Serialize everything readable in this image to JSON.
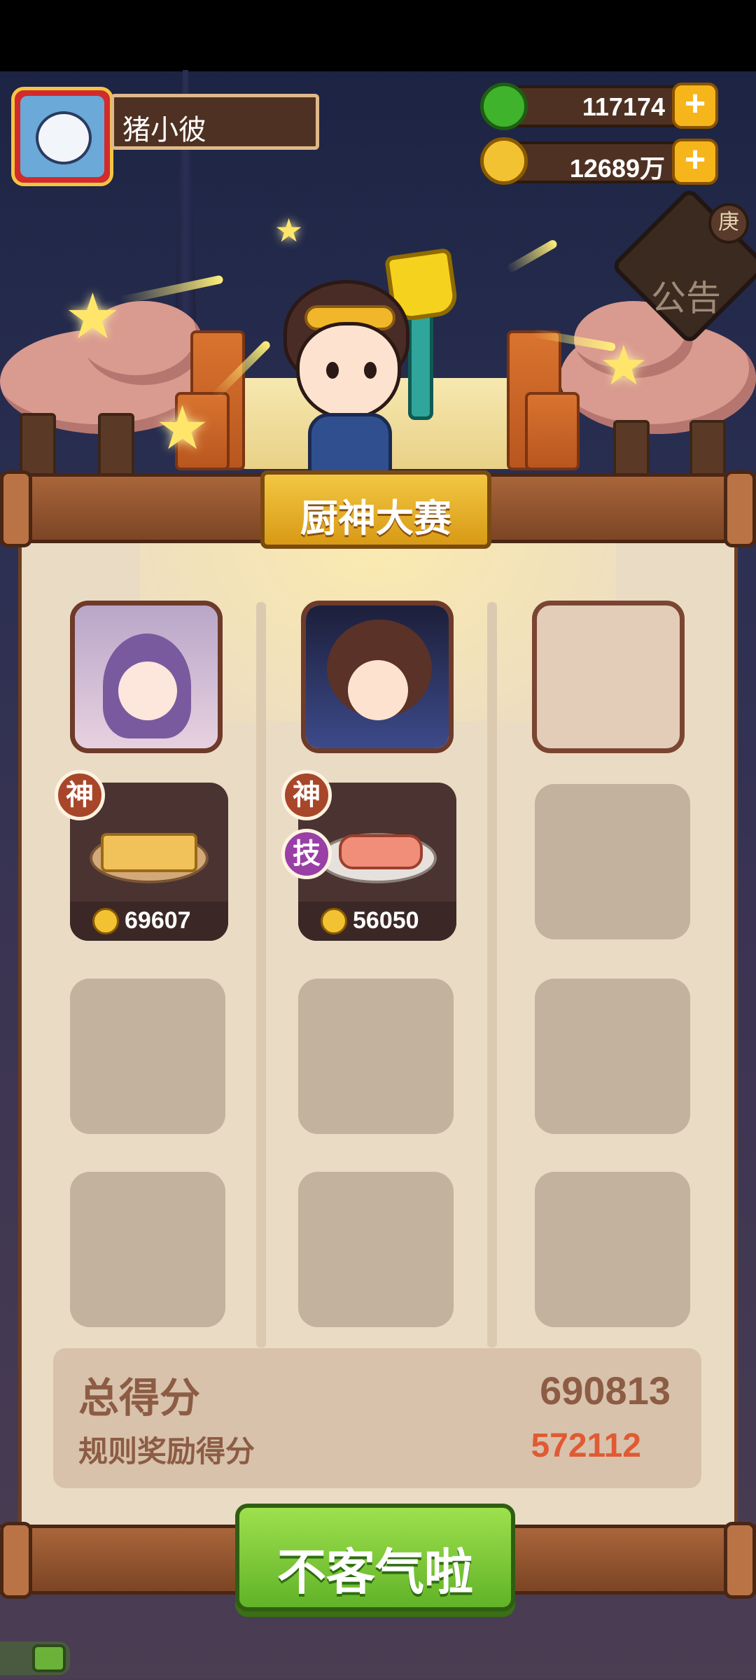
{
  "player": {
    "name": "猪小彼"
  },
  "currency": {
    "jade": {
      "value": "117174",
      "icon": "jade-icon",
      "color": "#3fb32b"
    },
    "gold": {
      "value": "12689万",
      "icon": "gold-coin-icon",
      "color": "#f3c233"
    },
    "plus_label": "+"
  },
  "notice": {
    "label": "公告",
    "badge": "庚"
  },
  "contest": {
    "title": "厨神大赛"
  },
  "columns": [
    {
      "chef": "chef-portrait-1",
      "dish_score": "69607",
      "badges": [
        "神"
      ]
    },
    {
      "chef": "chef-portrait-2",
      "dish_score": "56050",
      "badges": [
        "神",
        "技"
      ]
    },
    {
      "chef": "empty",
      "dish_score": "",
      "badges": []
    }
  ],
  "scores": {
    "total_label": "总得分",
    "total_value": "690813",
    "bonus_label": "规则奖励得分",
    "bonus_value": "572112"
  },
  "action": {
    "label": "不客气啦"
  },
  "colors": {
    "accent_green": "#61b328",
    "title_gold": "#f3c743",
    "bonus_red": "#e05a34"
  }
}
